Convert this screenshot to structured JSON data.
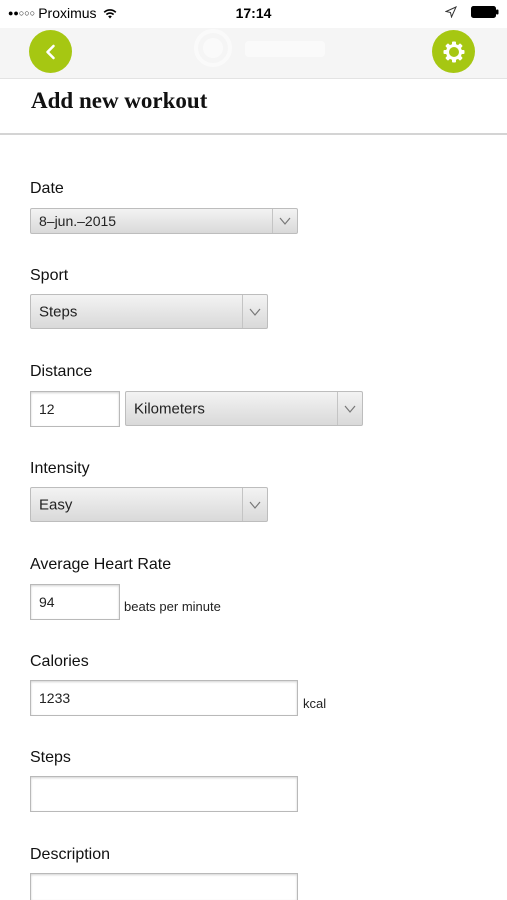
{
  "status_bar": {
    "carrier": "Proximus",
    "time": "17:14"
  },
  "nav": {
    "back_icon": "chevron-left-icon",
    "settings_icon": "gear-icon",
    "accent_color": "#a6c712"
  },
  "page": {
    "title": "Add new workout"
  },
  "form": {
    "date": {
      "label": "Date",
      "value": "8–jun.–2015"
    },
    "sport": {
      "label": "Sport",
      "value": "Steps"
    },
    "distance": {
      "label": "Distance",
      "value": "12",
      "unit": "Kilometers"
    },
    "intensity": {
      "label": "Intensity",
      "value": "Easy"
    },
    "heart_rate": {
      "label": "Average Heart Rate",
      "value": "94",
      "unit": "beats per minute"
    },
    "calories": {
      "label": "Calories",
      "value": "1233",
      "unit": "kcal"
    },
    "steps": {
      "label": "Steps",
      "value": ""
    },
    "description": {
      "label": "Description",
      "value": ""
    }
  }
}
